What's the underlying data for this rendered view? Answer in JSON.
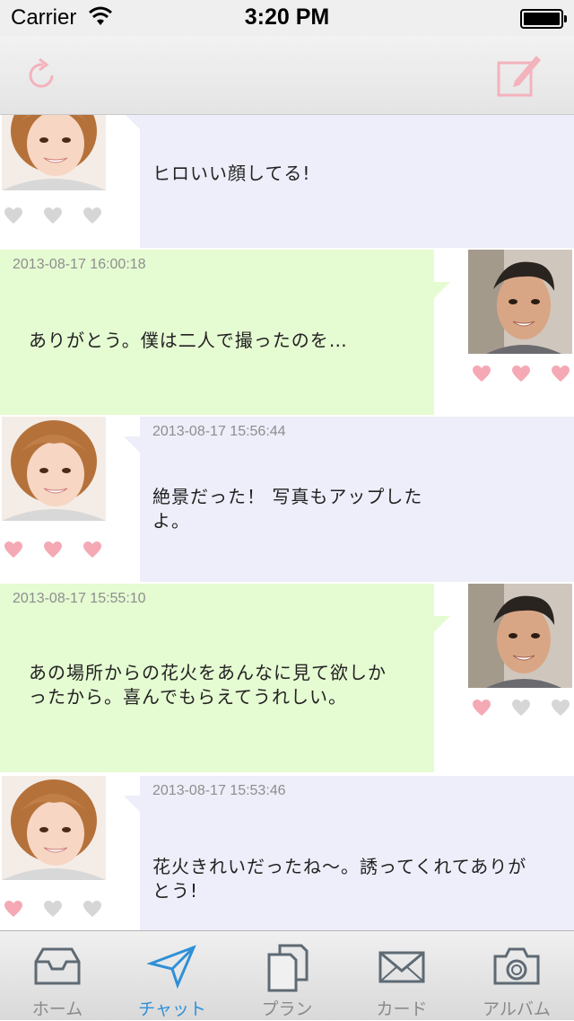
{
  "status_bar": {
    "carrier": "Carrier",
    "time": "3:20 PM"
  },
  "nav_bar": {
    "left_icon": "refresh-icon",
    "right_icon": "compose-icon",
    "accent": "#f5b8c0"
  },
  "messages": [
    {
      "side": "left",
      "timestamp": "",
      "text": "ヒロいい顔してる!",
      "likes": 0
    },
    {
      "side": "right",
      "timestamp": "2013-08-17 16:00:18",
      "text": "ありがとう。僕は二人で撮ったのを…",
      "likes": 3
    },
    {
      "side": "left",
      "timestamp": "2013-08-17 15:56:44",
      "text": "絶景だった！ 写真もアップしたよ。",
      "likes": 3
    },
    {
      "side": "right",
      "timestamp": "2013-08-17 15:55:10",
      "text": "あの場所からの花火をあんなに見て欲しかったから。喜んでもらえてうれしい。",
      "likes": 1
    },
    {
      "side": "left",
      "timestamp": "2013-08-17 15:53:46",
      "text": "花火きれいだったね〜。誘ってくれてありがとう!",
      "likes": 1
    }
  ],
  "tab_bar": {
    "tabs": [
      {
        "label": "ホーム",
        "icon": "inbox-icon",
        "active": false
      },
      {
        "label": "チャット",
        "icon": "paper-plane-icon",
        "active": true
      },
      {
        "label": "プラン",
        "icon": "documents-icon",
        "active": false
      },
      {
        "label": "カード",
        "icon": "envelope-icon",
        "active": false
      },
      {
        "label": "アルバム",
        "icon": "camera-icon",
        "active": false
      }
    ]
  },
  "colors": {
    "left_bubble": "#eeeefa",
    "right_bubble": "#e5fbd2",
    "heart_liked": "#f4a9b4",
    "heart_empty": "#d6d6d6",
    "tab_active": "#2f8fd8"
  }
}
